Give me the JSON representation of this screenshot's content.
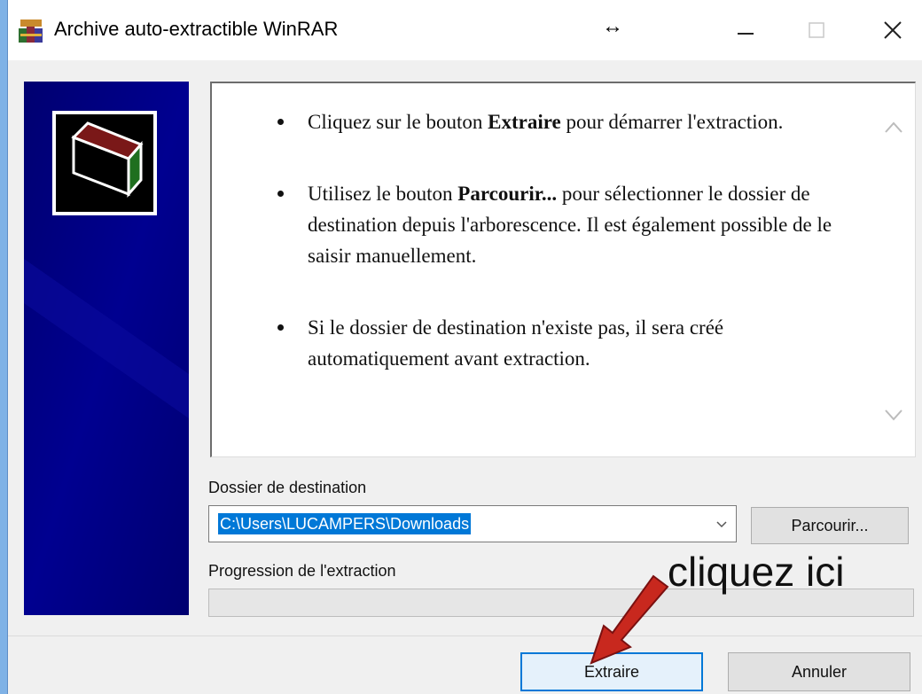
{
  "window": {
    "title": "Archive auto-extractible WinRAR",
    "controls": [
      "minimize",
      "maximize",
      "close"
    ]
  },
  "icons": {
    "app": "winrar-books-icon",
    "resize": "resize-horizontal-cursor-icon",
    "scroll_up": "chevron-up-icon",
    "scroll_down": "chevron-down-icon",
    "dropdown": "chevron-down-icon"
  },
  "colors": {
    "banner": "#000080",
    "selection": "#0078d7",
    "annotation_arrow": "#c8281e"
  },
  "instructions": [
    {
      "before": "Cliquez sur le bouton ",
      "bold": "Extraire",
      "after": " pour démarrer l'extraction."
    },
    {
      "before": "Utilisez le bouton ",
      "bold": "Parcourir...",
      "after": " pour sélectionner le dossier de destination depuis l'arborescence. Il est également possible de le saisir manuellement."
    },
    {
      "before": "Si le dossier de destination n'existe pas, il sera créé automatiquement avant extraction.",
      "bold": "",
      "after": ""
    }
  ],
  "destination": {
    "label": "Dossier de destination",
    "value": "C:\\Users\\LUCAMPERS\\Downloads",
    "browse_label": "Parcourir..."
  },
  "progress": {
    "label": "Progression de l'extraction",
    "fraction": 0
  },
  "buttons": {
    "extract": "Extraire",
    "cancel": "Annuler"
  },
  "annotation": {
    "text": "cliquez ici"
  }
}
